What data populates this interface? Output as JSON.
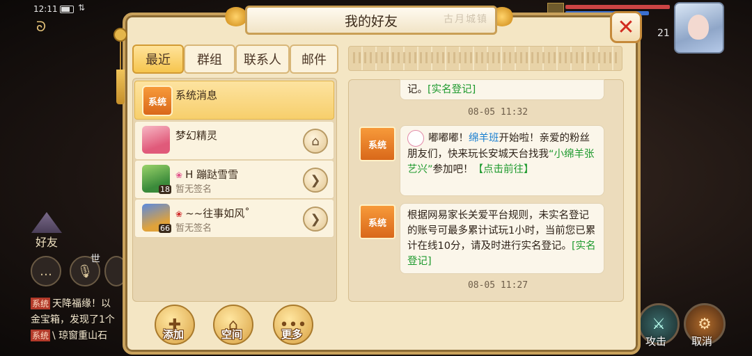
{
  "status_bar": {
    "time": "12:11"
  },
  "background": {
    "player_level": "21",
    "friends_side_label": "好友",
    "world_label": "世",
    "chat_lines": [
      {
        "tag": "系统",
        "text": "天降福缘！以"
      },
      {
        "tag": "",
        "text": "金宝箱，发现了1个"
      },
      {
        "tag": "系统",
        "text": "\\ 琼窗重山石"
      }
    ],
    "actions": {
      "attack": "攻击",
      "cancel": "取消"
    }
  },
  "dialog": {
    "title": "我的好友",
    "title_deco": "古月城镇",
    "close_glyph": "✕",
    "tabs": [
      {
        "label": "最近",
        "active": true
      },
      {
        "label": "群组",
        "active": false
      },
      {
        "label": "联系人",
        "active": false
      },
      {
        "label": "邮件",
        "active": false
      }
    ],
    "contacts": [
      {
        "name": "系统消息",
        "badge": "系统",
        "signature": "",
        "button": ""
      },
      {
        "name": "梦幻精灵",
        "badge": "",
        "signature": "",
        "button": "home"
      },
      {
        "name": "H 蹦跶雪雪",
        "badge": "",
        "level": "18",
        "signature": "暂无签名",
        "button": "arrow"
      },
      {
        "name": "~~往事如风˚",
        "badge": "",
        "level": "66",
        "signature": "暂无签名",
        "button": "arrow"
      }
    ],
    "bottom_buttons": [
      {
        "label": "添加",
        "icon": "add-friend-icon"
      },
      {
        "label": "空间",
        "icon": "house-icon"
      },
      {
        "label": "更多",
        "icon": "more-dots-icon"
      }
    ],
    "messages": {
      "top_fragment": {
        "text": "记。",
        "link": "[实名登记]"
      },
      "top_time": "08-05  11:32",
      "msg1": {
        "sender_badge": "系统",
        "part1": "嘟嘟嘟！",
        "highlight": "绵羊班",
        "part2": "开始啦！亲爱的粉丝朋友们，快来玩长安城天台找我",
        "quote": "“小绵羊张艺兴”",
        "part3": "参加吧！",
        "link": "【点击前往】"
      },
      "msg2": {
        "sender_badge": "系统",
        "text": "根据网易家长关爱平台规则，未实名登记的账号可最多累计试玩1小时，当前您已累计在线10分，请及时进行实名登记。",
        "link": "[实名登记]"
      },
      "bottom_time": "08-05  11:27"
    }
  },
  "colors": {
    "accent_gold": "#f6c54e",
    "link_green": "#1e9a2e",
    "highlight_blue": "#1a7fd0",
    "close_red": "#d22b1f"
  }
}
